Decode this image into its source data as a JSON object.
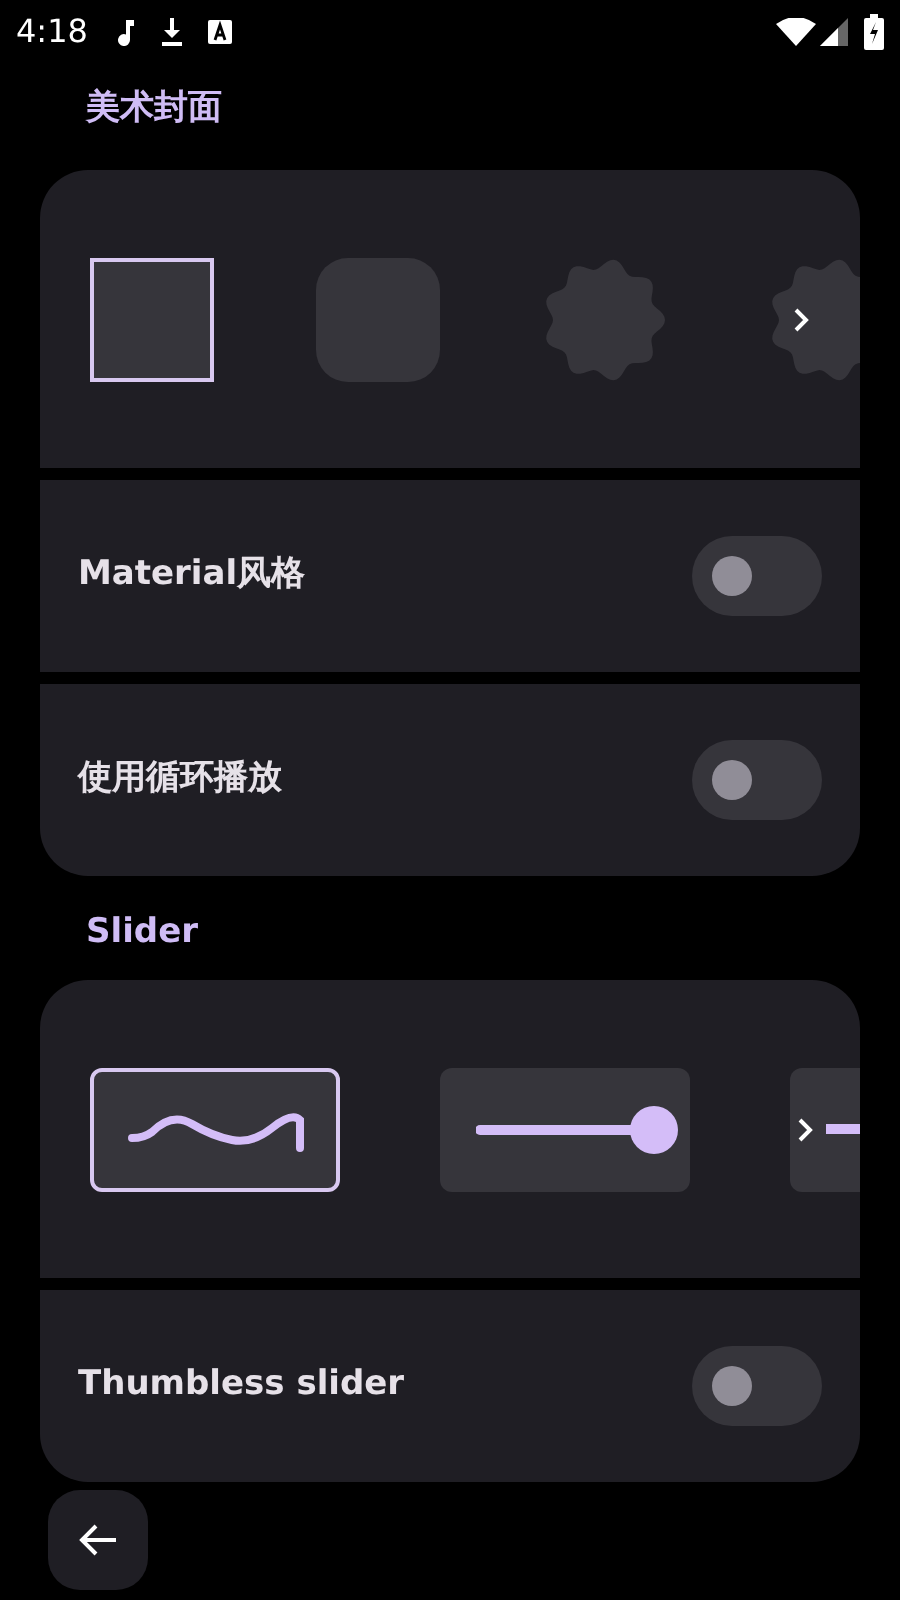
{
  "status_bar": {
    "time": "4:18"
  },
  "sections": [
    {
      "title": "美术封面",
      "options": [
        {
          "kind": "square",
          "selected": true
        },
        {
          "kind": "rounded",
          "selected": false
        },
        {
          "kind": "scalloped",
          "selected": false
        },
        {
          "kind": "scalloped",
          "selected": false,
          "more": true
        }
      ],
      "toggles": [
        {
          "label": "Material风格",
          "on": false
        },
        {
          "label": "使用循环播放",
          "on": false
        }
      ]
    },
    {
      "title": "Slider",
      "options": [
        {
          "kind": "wavy",
          "selected": true
        },
        {
          "kind": "thumb",
          "selected": false
        },
        {
          "kind": "thumbless",
          "selected": false,
          "more": true
        }
      ],
      "toggles": [
        {
          "label": "Thumbless slider",
          "on": false
        }
      ]
    }
  ]
}
